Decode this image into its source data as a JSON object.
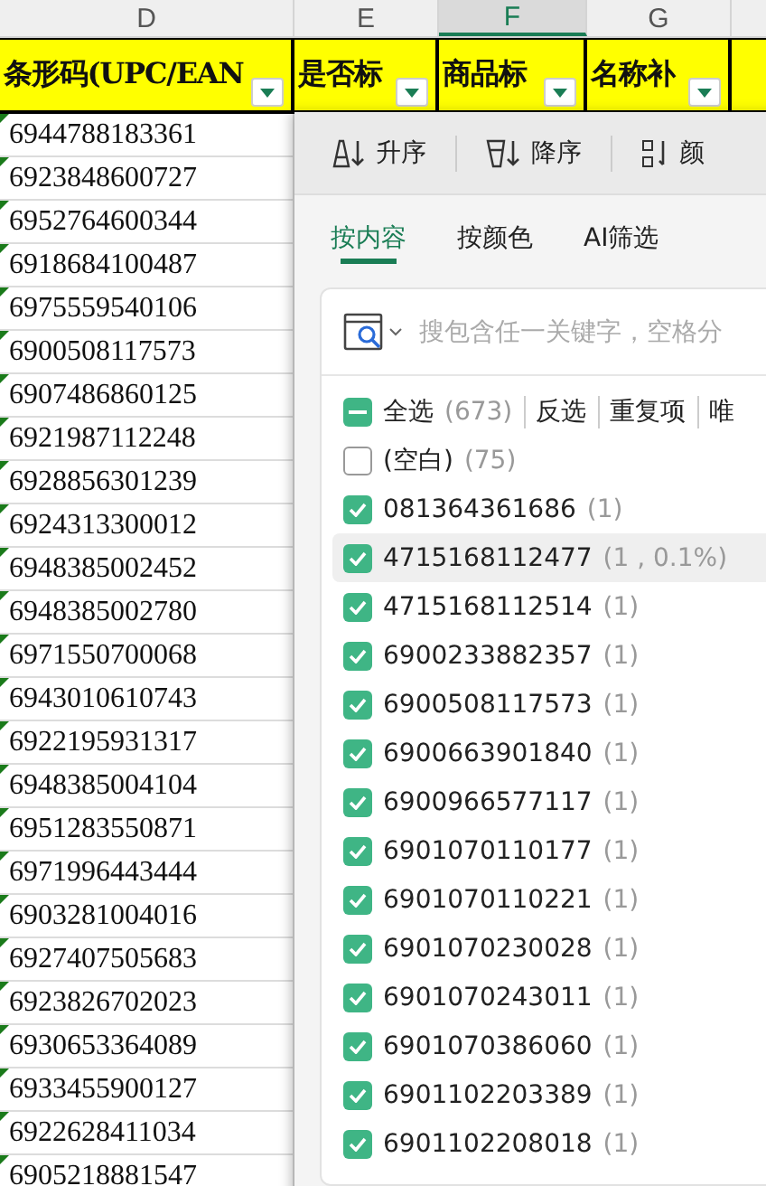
{
  "columns": [
    {
      "letter": "D",
      "selected": false
    },
    {
      "letter": "E",
      "selected": false
    },
    {
      "letter": "F",
      "selected": true
    },
    {
      "letter": "G",
      "selected": false
    },
    {}
  ],
  "header_cells": [
    {
      "text": "条形码(UPC/EAN"
    },
    {
      "text": "是否标"
    },
    {
      "text": "商品标"
    },
    {
      "text": "名称补"
    },
    {}
  ],
  "rows": [
    "6944788183361",
    "6923848600727",
    "6952764600344",
    "6918684100487",
    "6975559540106",
    "6900508117573",
    "6907486860125",
    "6921987112248",
    "6928856301239",
    "6924313300012",
    "6948385002452",
    "6948385002780",
    "6971550700068",
    "6943010610743",
    "6922195931317",
    "6948385004104",
    "6951283550871",
    "6971996443444",
    "6903281004016",
    "6927407505683",
    "6923826702023",
    "6930653364089",
    "6933455900127",
    "6922628411034",
    "6905218881547"
  ],
  "filter_panel": {
    "toolbar": [
      {
        "kind": "ascending",
        "label": "升序"
      },
      {
        "kind": "descending",
        "label": "降序"
      },
      {
        "kind": "color",
        "label": "颜"
      }
    ],
    "tabs": [
      {
        "label": "按内容",
        "selected": true
      },
      {
        "label": "按颜色",
        "selected": false
      },
      {
        "label": "AI筛选",
        "selected": false
      }
    ],
    "search": {
      "placeholder": "搜包含任一关键字，空格分"
    },
    "select_all": {
      "label": "全选",
      "count": "(673)",
      "indeterminate": true
    },
    "actions": [
      "反选",
      "重复项",
      "唯"
    ],
    "items": [
      {
        "value": "(空白)",
        "count": "(75)",
        "checked": false,
        "hovered": false
      },
      {
        "value": "081364361686",
        "count": "(1)",
        "checked": true,
        "hovered": false
      },
      {
        "value": "4715168112477",
        "count": "(1 , 0.1%)",
        "checked": true,
        "hovered": true
      },
      {
        "value": "4715168112514",
        "count": "(1)",
        "checked": true,
        "hovered": false
      },
      {
        "value": "6900233882357",
        "count": "(1)",
        "checked": true,
        "hovered": false
      },
      {
        "value": "6900508117573",
        "count": "(1)",
        "checked": true,
        "hovered": false
      },
      {
        "value": "6900663901840",
        "count": "(1)",
        "checked": true,
        "hovered": false
      },
      {
        "value": "6900966577117",
        "count": "(1)",
        "checked": true,
        "hovered": false
      },
      {
        "value": "6901070110177",
        "count": "(1)",
        "checked": true,
        "hovered": false
      },
      {
        "value": "6901070110221",
        "count": "(1)",
        "checked": true,
        "hovered": false
      },
      {
        "value": "6901070230028",
        "count": "(1)",
        "checked": true,
        "hovered": false
      },
      {
        "value": "6901070243011",
        "count": "(1)",
        "checked": true,
        "hovered": false
      },
      {
        "value": "6901070386060",
        "count": "(1)",
        "checked": true,
        "hovered": false
      },
      {
        "value": "6901102203389",
        "count": "(1)",
        "checked": true,
        "hovered": false
      },
      {
        "value": "6901102208018",
        "count": "(1)",
        "checked": true,
        "hovered": false
      }
    ]
  }
}
